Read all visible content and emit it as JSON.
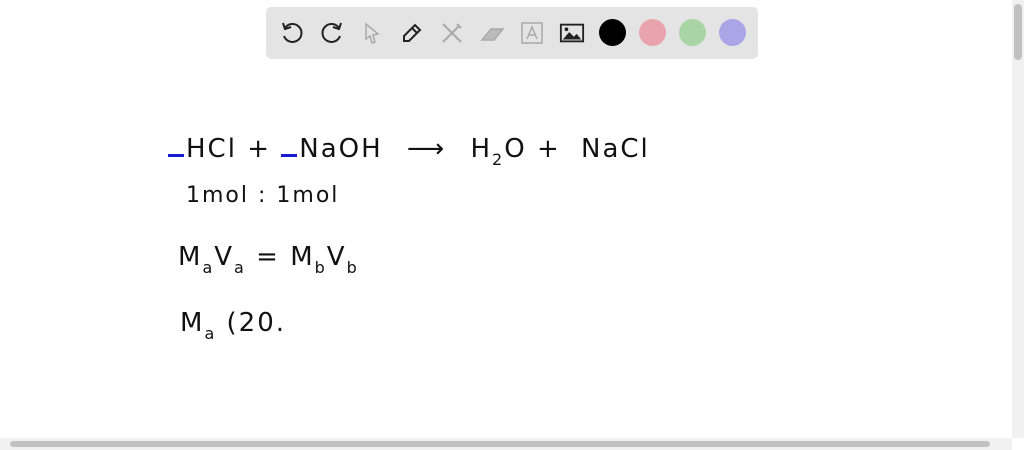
{
  "toolbar": {
    "tools": [
      "undo",
      "redo",
      "select",
      "pen",
      "tools",
      "eraser",
      "text",
      "image"
    ],
    "colors": {
      "black": "#000000",
      "pink": "#e8a3ac",
      "green": "#a9d5a4",
      "purple": "#aaa5e6"
    }
  },
  "canvas": {
    "line1": {
      "reactant1": "HCl +",
      "reactant2": "NaOH",
      "arrow": "⟶",
      "product1a": "H",
      "product1sub": "2",
      "product1b": "O +",
      "product2": "NaCl"
    },
    "line2": "1mol : 1mol",
    "line3": {
      "m1": "M",
      "s1": "a",
      "v1": "V",
      "s2": "a",
      "eq": "=",
      "m2": "M",
      "s3": "b",
      "v2": "V",
      "s4": "b"
    },
    "line4": {
      "m": "M",
      "s": "a",
      "rest": "(20."
    }
  }
}
